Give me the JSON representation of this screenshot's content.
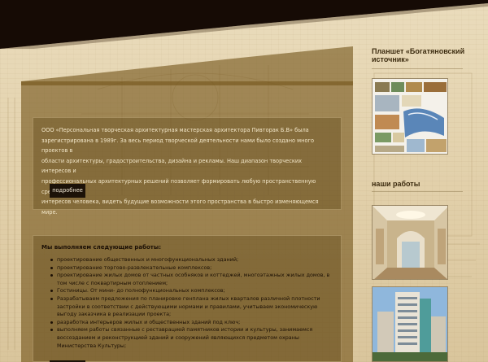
{
  "intro": [
    "ООО «Персональная творческая архитектурная мастерская архитектора Пивторак Б.В» была",
    "зарегистрирована в 1989г. За весь период творческой деятельности нами было создано много проектов в",
    "области архитектуры, градостроительства, дизайна и рекламы. Наш диапазон творческих интересов и",
    "профессиональных архитектурных решений позволяет формировать любую пространственную среду",
    "интересов человека, видеть будущие возможности этого пространства в быстро изменяющемся мире."
  ],
  "more_label": "подробнее",
  "works_heading": "Мы выполняем следующие работы:",
  "works": [
    "проектирование общественных и многофункциональных зданий;",
    "проектирование торгово-развлекательные комплексов;",
    "проектирование жилых домов от частных особняков и коттеджей, многоэтажных жилых домов, в том числе с покварт­ирным отоплением;",
    "Гостиницы. От мини- до полнофункциональных комплексов;",
    "Разрабатываем предложения по планировке генплана жилых кварталов различной плотности застройки в соответствии с действующими нормами и правилами, учитываем экономическую выгоду заказчика в реализации проекта;",
    "разработка интерьеров жилых и общественных зданий под ключ;",
    "выполняем работы связанные с реставрацией памятников истории и культуры, занимаемся воссозданием и реконструкцией зданий и сооружений являющихся предметом охраны Министерства Культуры;"
  ],
  "sidebar": {
    "plan_title": "Планшет «Богатяновский источник»",
    "works_title": "наши работы"
  }
}
